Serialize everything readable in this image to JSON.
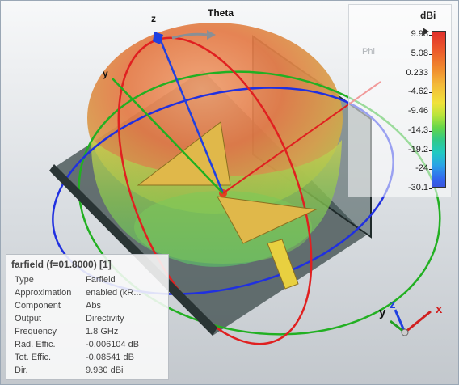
{
  "viewport": {
    "theta_label": "Theta",
    "phi_label": "Phi",
    "axis_labels": {
      "z": "z",
      "y": "y"
    }
  },
  "colorbar": {
    "unit": "dBi",
    "ticks": [
      "9.93",
      "5.08",
      "0.233",
      "-4.62",
      "-9.46",
      "-14.3",
      "-19.2",
      "-24",
      "-30.1"
    ]
  },
  "info": {
    "title": "farfield (f=01.8000) [1]",
    "rows": [
      {
        "key": "Type",
        "value": "Farfield"
      },
      {
        "key": "Approximation",
        "value": "enabled (kR..."
      },
      {
        "key": "Component",
        "value": "Abs"
      },
      {
        "key": "Output",
        "value": "Directivity"
      },
      {
        "key": "Frequency",
        "value": "1.8 GHz"
      },
      {
        "key": "Rad. Effic.",
        "value": "-0.006104 dB"
      },
      {
        "key": "Tot. Effic.",
        "value": "-0.08541 dB"
      },
      {
        "key": "Dir.",
        "value": "9.930 dBi"
      }
    ]
  },
  "triad": {
    "x": "x",
    "y": "y",
    "z": "z"
  },
  "colors": {
    "x_axis": "#e02020",
    "y_axis": "#20b020",
    "z_axis": "#2040e0"
  }
}
